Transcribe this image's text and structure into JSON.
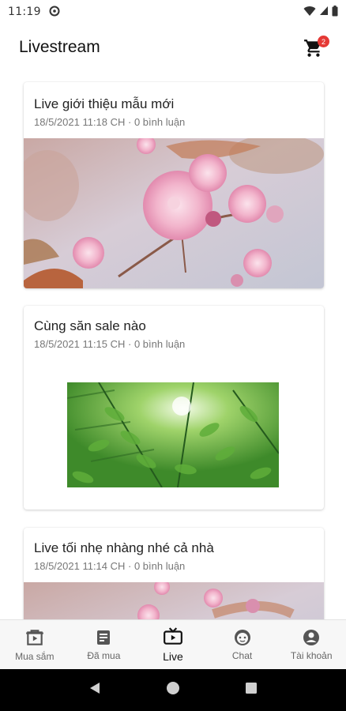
{
  "status_bar": {
    "time": "11:19"
  },
  "header": {
    "title": "Livestream",
    "cart_count": "2"
  },
  "feed": {
    "items": [
      {
        "title": "Live giới thiệu mẫu mới",
        "meta": "18/5/2021 11:18 CH · 0 bình luận"
      },
      {
        "title": "Cùng săn sale nào",
        "meta": "18/5/2021 11:15 CH · 0 bình luận"
      },
      {
        "title": "Live tối nhẹ nhàng nhé cả nhà",
        "meta": "18/5/2021 11:14 CH · 0 bình luận"
      }
    ]
  },
  "bottom_nav": {
    "items": [
      {
        "label": "Mua sắm",
        "icon": "shopping-bag-icon"
      },
      {
        "label": "Đã mua",
        "icon": "receipt-icon"
      },
      {
        "label": "Live",
        "icon": "tv-icon"
      },
      {
        "label": "Chat",
        "icon": "chat-face-icon"
      },
      {
        "label": "Tài khoản",
        "icon": "account-icon"
      }
    ],
    "active_index": 2
  },
  "colors": {
    "badge": "#e53935",
    "nav_background": "#f7f7f7",
    "text_primary": "#212121",
    "text_secondary": "#777777"
  }
}
